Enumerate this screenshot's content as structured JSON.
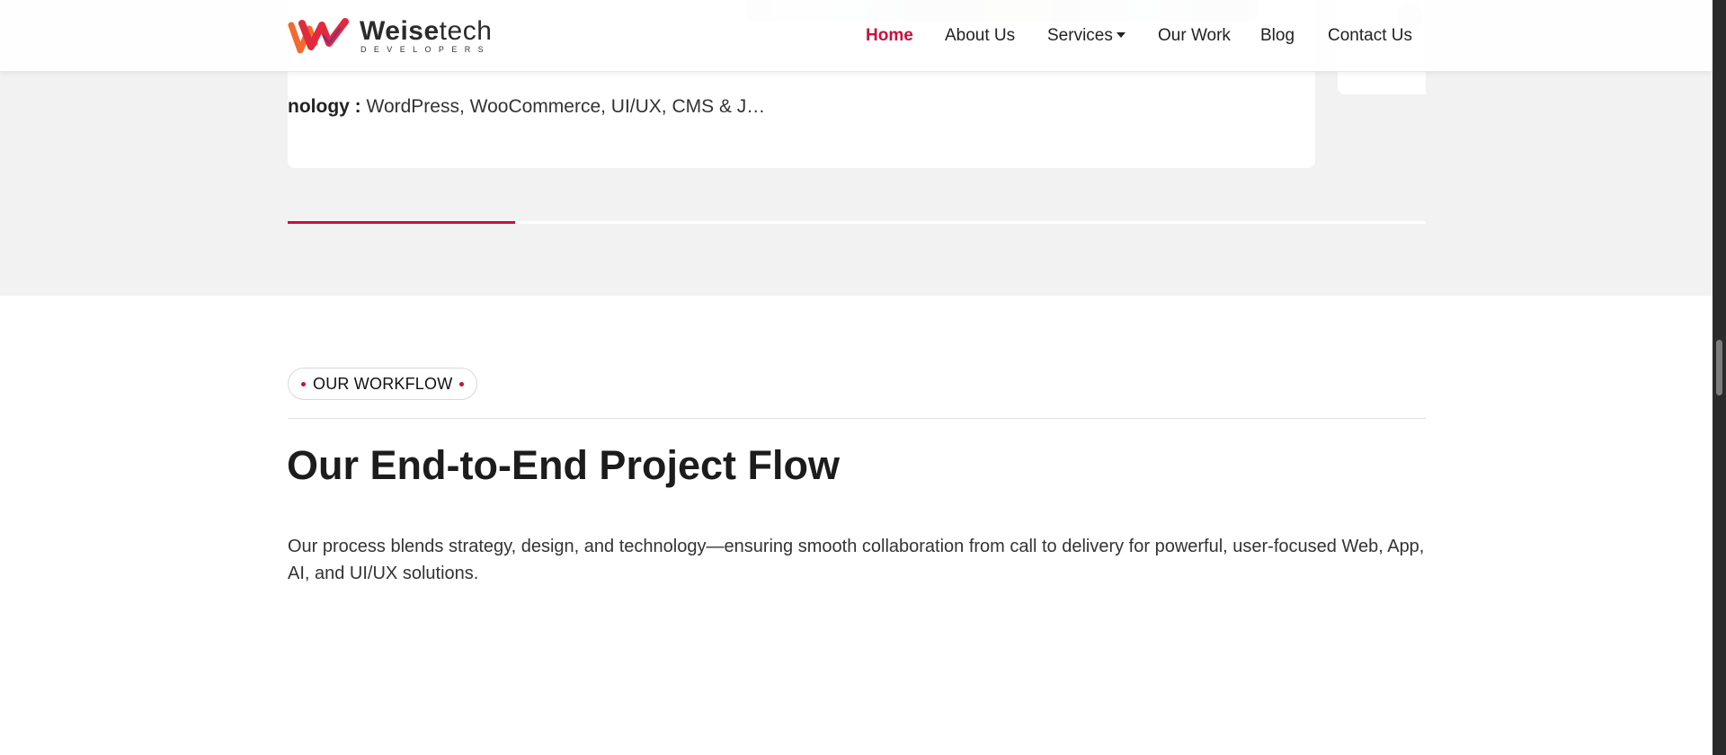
{
  "header": {
    "logo": {
      "name_bold": "Weise",
      "name_light": "tech",
      "tagline": "DEVELOPERS",
      "colors": {
        "red": "#e02b3c",
        "orange": "#f26b2e",
        "purple": "#7a2a8c"
      }
    },
    "nav": [
      {
        "label": "Home",
        "active": true
      },
      {
        "label": "About Us"
      },
      {
        "label": "Services",
        "has_dropdown": true
      },
      {
        "label": "Our Work"
      },
      {
        "label": "Blog"
      },
      {
        "label": "Contact Us"
      }
    ]
  },
  "portfolio_card": {
    "technology_label": "nology :",
    "technology_value": "WordPress, WooCommerce, UI/UX, CMS & J…",
    "slider_progress": 0.2
  },
  "workflow": {
    "tag": "OUR WORKFLOW",
    "heading": "Our End-to-End Project Flow",
    "description": "Our process blends strategy, design, and technology—ensuring smooth collaboration from call to delivery for powerful, user-focused Web, App, AI, and UI/UX solutions."
  },
  "colors": {
    "accent": "#c8103e",
    "band_background": "#f2f2f2",
    "text": "#222222"
  }
}
